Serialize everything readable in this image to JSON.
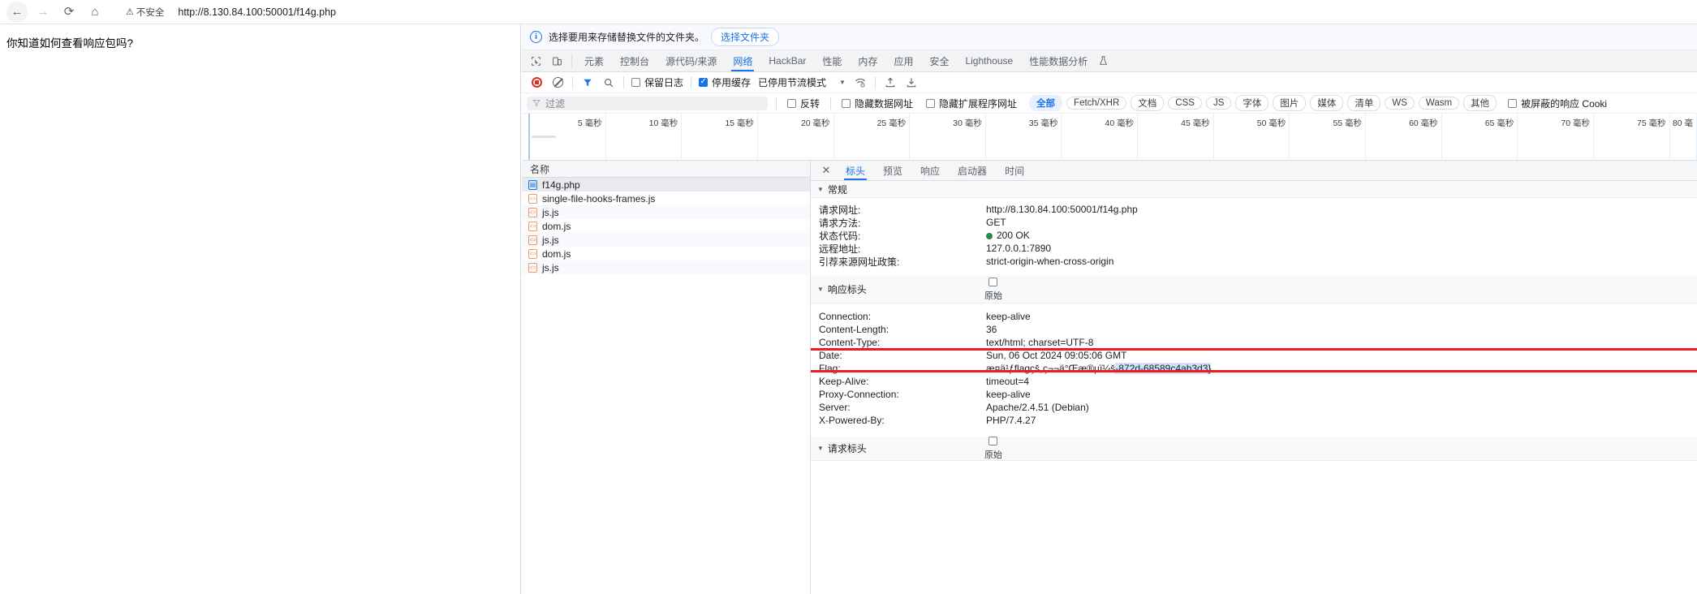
{
  "browser": {
    "back_icon": "arrow-left-icon",
    "forward_icon": "arrow-right-icon",
    "reload_icon": "reload-icon",
    "home_icon": "home-icon",
    "security_label": "不安全",
    "security_icon": "warning-triangle-icon",
    "url": "http://8.130.84.100:50001/f14g.php"
  },
  "page": {
    "text": "你知道如何查看响应包吗?"
  },
  "devtools": {
    "banner": {
      "icon": "info-circle-icon",
      "message": "选择要用来存储替换文件的文件夹。",
      "button": "选择文件夹"
    },
    "toolbar_icons": [
      {
        "name": "inspect-element-icon"
      },
      {
        "name": "device-toolbar-icon"
      }
    ],
    "tabs": [
      {
        "label": "元素",
        "active": false
      },
      {
        "label": "控制台",
        "active": false
      },
      {
        "label": "源代码/来源",
        "active": false
      },
      {
        "label": "网络",
        "active": true
      },
      {
        "label": "HackBar",
        "active": false
      },
      {
        "label": "性能",
        "active": false
      },
      {
        "label": "内存",
        "active": false
      },
      {
        "label": "应用",
        "active": false
      },
      {
        "label": "安全",
        "active": false
      },
      {
        "label": "Lighthouse",
        "active": false
      },
      {
        "label": "性能数据分析",
        "active": false
      }
    ],
    "tabs_extra_icon": "beaker-icon",
    "network_toolbar": {
      "record_icon": "record-stop-icon",
      "clear_icon": "clear-ban-icon",
      "filter_icon": "funnel-icon",
      "search_icon": "search-icon",
      "preserve_log_label": "保留日志",
      "preserve_log_checked": false,
      "disable_cache_label": "停用缓存",
      "disable_cache_checked": true,
      "throttle_value": "已停用节流模式",
      "wifi_icon": "network-conditions-icon",
      "import_icon": "import-har-icon",
      "export_icon": "export-har-icon"
    },
    "filter_row": {
      "filter_placeholder": "过滤",
      "filter_icon": "funnel-icon",
      "invert_label": "反转",
      "invert_checked": false,
      "hide_data_urls_label": "隐藏数据网址",
      "hide_data_urls_checked": false,
      "hide_ext_urls_label": "隐藏扩展程序网址",
      "hide_ext_urls_checked": false,
      "type_chips": [
        {
          "label": "全部",
          "active": true
        },
        {
          "label": "Fetch/XHR",
          "active": false
        },
        {
          "label": "文档",
          "active": false
        },
        {
          "label": "CSS",
          "active": false
        },
        {
          "label": "JS",
          "active": false
        },
        {
          "label": "字体",
          "active": false
        },
        {
          "label": "图片",
          "active": false
        },
        {
          "label": "媒体",
          "active": false
        },
        {
          "label": "清单",
          "active": false
        },
        {
          "label": "WS",
          "active": false
        },
        {
          "label": "Wasm",
          "active": false
        },
        {
          "label": "其他",
          "active": false
        }
      ],
      "blocked_cookies_label": "被屏蔽的响应 Cooki",
      "blocked_cookies_checked": false
    },
    "timeline_ticks": [
      "5 毫秒",
      "10 毫秒",
      "15 毫秒",
      "20 毫秒",
      "25 毫秒",
      "30 毫秒",
      "35 毫秒",
      "40 毫秒",
      "45 毫秒",
      "50 毫秒",
      "55 毫秒",
      "60 毫秒",
      "65 毫秒",
      "70 毫秒",
      "75 毫秒",
      "80 毫"
    ],
    "requests": {
      "column_header": "名称",
      "rows": [
        {
          "name": "f14g.php",
          "type": "doc",
          "selected": true
        },
        {
          "name": "single-file-hooks-frames.js",
          "type": "js",
          "selected": false
        },
        {
          "name": "js.js",
          "type": "js",
          "selected": false
        },
        {
          "name": "dom.js",
          "type": "js",
          "selected": false
        },
        {
          "name": "js.js",
          "type": "js",
          "selected": false
        },
        {
          "name": "dom.js",
          "type": "js",
          "selected": false
        },
        {
          "name": "js.js",
          "type": "js",
          "selected": false
        }
      ]
    },
    "details": {
      "close_icon": "close-icon",
      "tabs": [
        {
          "label": "标头",
          "active": true
        },
        {
          "label": "预览",
          "active": false
        },
        {
          "label": "响应",
          "active": false
        },
        {
          "label": "启动器",
          "active": false
        },
        {
          "label": "时间",
          "active": false
        }
      ],
      "general": {
        "section_title": "常规",
        "rows": [
          {
            "key": "请求网址:",
            "value": "http://8.130.84.100:50001/f14g.php"
          },
          {
            "key": "请求方法:",
            "value": "GET"
          },
          {
            "key": "状态代码:",
            "value": "200 OK",
            "dot": "#1e8e3e"
          },
          {
            "key": "远程地址:",
            "value": "127.0.0.1:7890"
          },
          {
            "key": "引荐来源网址政策:",
            "value": "strict-origin-when-cross-origin"
          }
        ]
      },
      "response_headers": {
        "section_title": "响应标头",
        "raw_label": "原始",
        "raw_checked": false,
        "rows": [
          {
            "key": "Connection:",
            "value": "keep-alive"
          },
          {
            "key": "Content-Length:",
            "value": "36"
          },
          {
            "key": "Content-Type:",
            "value": "text/html; charset=UTF-8"
          },
          {
            "key": "Date:",
            "value": "Sun, 06 Oct 2024 09:05:06 GMT"
          },
          {
            "key": "Flag:",
            "value": "æ¤ä¹ƒflagçš„ç¬¬ä°Œæ®µï¼š",
            "value_highlight": "-872d-68589c4ab3d3}",
            "highlighted": true
          },
          {
            "key": "Keep-Alive:",
            "value": "timeout=4"
          },
          {
            "key": "Proxy-Connection:",
            "value": "keep-alive"
          },
          {
            "key": "Server:",
            "value": "Apache/2.4.51 (Debian)"
          },
          {
            "key": "X-Powered-By:",
            "value": "PHP/7.4.27"
          }
        ]
      },
      "request_headers": {
        "section_title": "请求标头",
        "raw_label": "原始",
        "raw_checked": false
      },
      "annotation_color": "#ee1b24"
    }
  }
}
